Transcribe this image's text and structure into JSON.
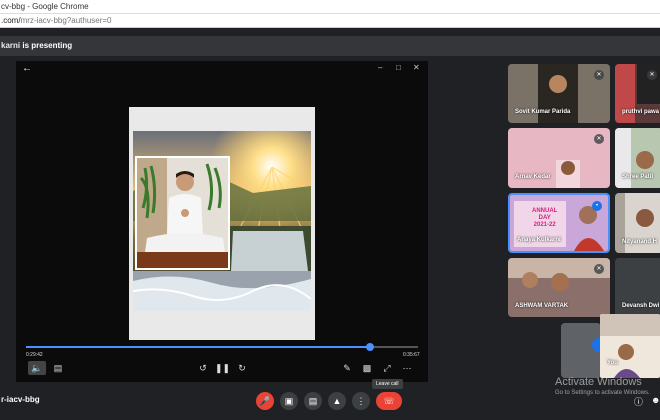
{
  "browser": {
    "title": "cv-bbg - Google Chrome",
    "url_host": ".com/",
    "url_path": "mrz-iacv-bbg?authuser=0"
  },
  "presenting": {
    "name_fragment": "karni",
    "suffix": " is presenting"
  },
  "player": {
    "current_time": "0:29:42",
    "total_time": "0:35:67",
    "progress_fraction": 0.877,
    "icons": {
      "back": "arrow-back-icon",
      "minimize": "minimize-icon",
      "restore": "restore-icon",
      "close": "close-icon",
      "volume": "volume-icon",
      "captions": "captions-icon",
      "rewind": "rewind-icon",
      "pause": "pause-icon",
      "forward": "forward-icon",
      "pen": "pen-icon",
      "miniplayer": "miniplayer-icon",
      "fullscreen": "fullscreen-icon",
      "more": "more-icon"
    }
  },
  "participants": [
    {
      "name": "Sovit Kumar Parida"
    },
    {
      "name": "pruthvi pawa"
    },
    {
      "name": "Arnav Kedar"
    },
    {
      "name": "Shree Patil"
    },
    {
      "name": "Anaya Kulkarni"
    },
    {
      "name": "Nityanand H"
    },
    {
      "name": "ASHWAM VARTAK"
    },
    {
      "name": "Devansh Dwi"
    },
    {
      "name": "You"
    }
  ],
  "annual_day_text": {
    "line1": "ANNUAL",
    "line2": "DAY",
    "line3": "2021-22"
  },
  "bottom": {
    "meeting_code": "r-iacv-bbg",
    "tooltip": "Leave call",
    "buttons": {
      "mic": "mic-off-icon",
      "camera": "camera-icon",
      "captions": "captions-icon",
      "present": "present-icon",
      "more": "more-options-icon",
      "leave": "end-call-icon"
    }
  },
  "activate": {
    "title": "Activate Windows",
    "subtitle": "Go to Settings to activate Windows."
  },
  "colors": {
    "accent_blue": "#4a90ff",
    "leave_red": "#ea4335",
    "background": "#202124"
  }
}
